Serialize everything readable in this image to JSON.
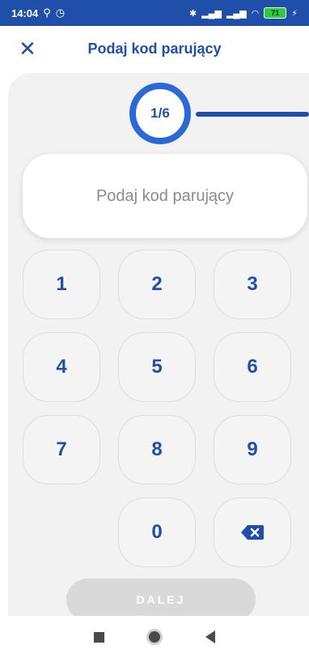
{
  "status_bar": {
    "time": "14:04",
    "battery": "71"
  },
  "header": {
    "title": "Podaj kod parujący"
  },
  "progress": {
    "step_label": "1/6"
  },
  "code_field": {
    "placeholder": "Podaj kod parujący",
    "value": ""
  },
  "keypad": {
    "keys": [
      "1",
      "2",
      "3",
      "4",
      "5",
      "6",
      "7",
      "8",
      "9",
      "0"
    ]
  },
  "next_button": {
    "label": "DALEJ"
  },
  "colors": {
    "accent": "#1f4fa8",
    "progress_ring": "#2b68d8",
    "disabled_button": "#d9d9d9"
  }
}
